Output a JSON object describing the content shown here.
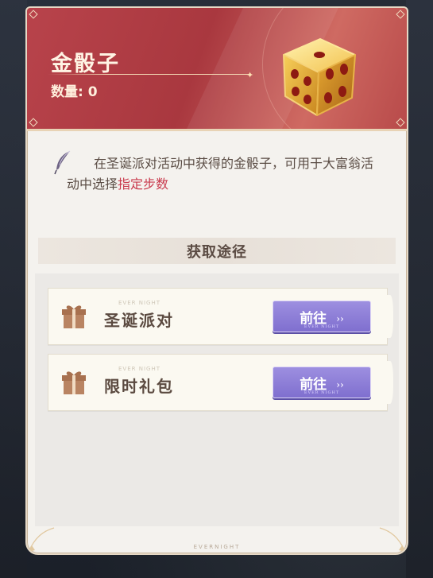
{
  "item": {
    "title": "金骰子",
    "quantity": "数量: 0"
  },
  "description": {
    "text": "在圣诞派对活动中获得的金骰子，可用于大富翁活动中选择",
    "highlight": "指定步数"
  },
  "section": {
    "title": "获取途径"
  },
  "routes": [
    {
      "label": "圣诞派对",
      "tag": "EVER NIGHT",
      "button": "前往",
      "button_sub": "EVER NIGHT",
      "arrows": "››"
    },
    {
      "label": "限时礼包",
      "tag": "EVER NIGHT",
      "button": "前往",
      "button_sub": "EVER NIGHT",
      "arrows": "››"
    }
  ],
  "footer": {
    "brand": "EVERNIGHT"
  },
  "colors": {
    "header_red": "#b8434b",
    "button_purple": "#8a7bd8",
    "highlight_red": "#c93a4d"
  }
}
